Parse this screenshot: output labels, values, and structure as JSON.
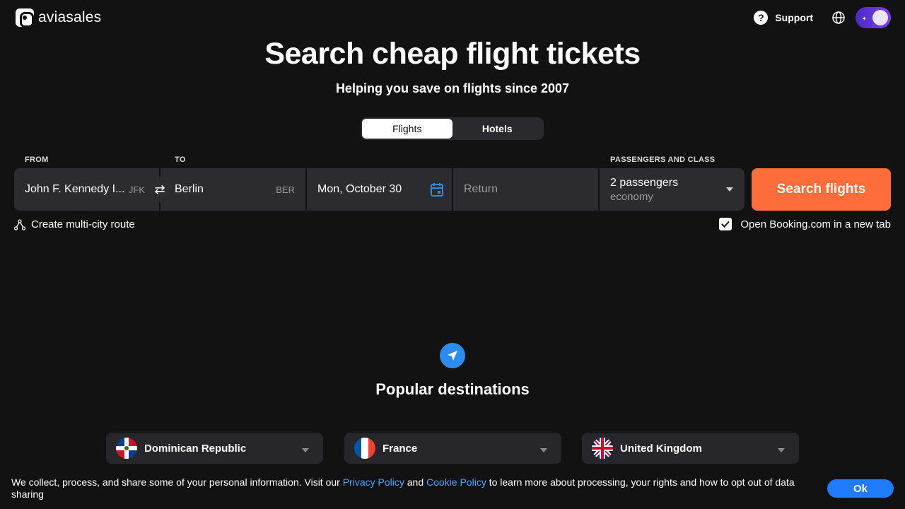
{
  "header": {
    "logo_text": "aviasales",
    "support_label": "Support",
    "support_icon": "question-icon",
    "language_icon": "globe-icon",
    "theme_toggle": "dark-mode-toggle"
  },
  "hero": {
    "title": "Search cheap flight tickets",
    "subtitle": "Helping you save on flights since 2007"
  },
  "tabs": [
    {
      "label": "Flights",
      "active": true
    },
    {
      "label": "Hotels",
      "active": false
    }
  ],
  "search": {
    "from_label": "FROM",
    "to_label": "TO",
    "passengers_label": "PASSENGERS AND CLASS",
    "from_value": "John F. Kennedy I...",
    "from_code": "JFK",
    "to_value": "Berlin",
    "to_code": "BER",
    "depart_value": "Mon, October 30",
    "return_placeholder": "Return",
    "passengers_value": "2 passengers",
    "class_value": "economy",
    "search_button": "Search flights",
    "multicity_label": "Create multi-city route",
    "booking_label": "Open Booking.com in a new tab",
    "booking_checked": true
  },
  "popular": {
    "title": "Popular destinations",
    "items": [
      {
        "label": "Dominican Republic",
        "flag": "dominican-republic-flag"
      },
      {
        "label": "France",
        "flag": "france-flag"
      },
      {
        "label": "United Kingdom",
        "flag": "united-kingdom-flag"
      }
    ]
  },
  "cookie": {
    "text_1": "We collect, process, and share some of your personal information. Visit our ",
    "privacy_link": "Privacy Policy",
    "text_2": " and ",
    "cookie_link": "Cookie Policy",
    "text_3": " to learn more about processing, your rights and how to opt out of data sharing",
    "ok_button": "Ok"
  },
  "colors": {
    "background": "#121212",
    "field": "#2c2c30",
    "accent_orange": "#ff6d3a",
    "link_blue": "#4aa3ff",
    "ok_blue": "#1f7bff"
  }
}
